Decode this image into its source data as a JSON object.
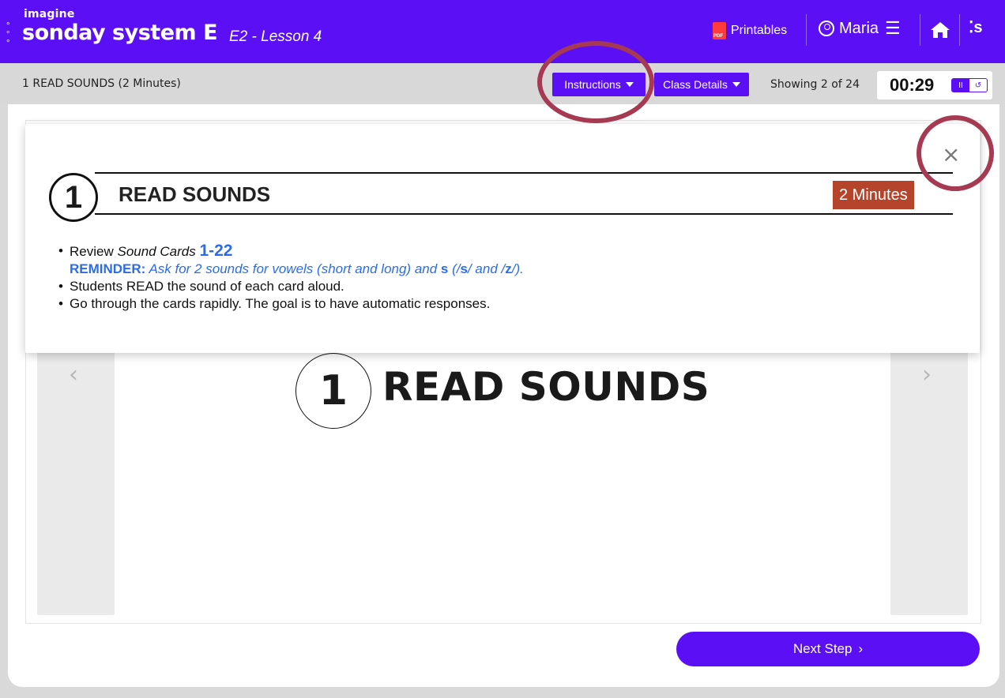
{
  "header": {
    "logo_small": "imagine",
    "logo_main": "sonday system",
    "logo_letter": "E",
    "lesson": "E2 - Lesson 4",
    "printables_label": "Printables",
    "user_name": "Maria",
    "menu_glyph": "☰",
    "s_glyph": "s"
  },
  "subbar": {
    "step_title": "1 READ SOUNDS (2 Minutes)",
    "instructions_label": "Instructions",
    "class_details_label": "Class Details",
    "showing": "Showing 2 of 24",
    "timer": "00:29",
    "pause_glyph": "II",
    "reset_glyph": "↺"
  },
  "popup": {
    "close_glyph": "×",
    "number": "1",
    "title": "READ SOUNDS",
    "minutes": "2 Minutes",
    "bullet1_prefix": "Review",
    "bullet1_italic": "Sound Cards",
    "bullet1_num": "1-22",
    "reminder_label": "REMINDER:",
    "reminder_text": "Ask for 2 sounds for vowels (short and long) and",
    "reminder_s": "s",
    "reminder_open": "(/",
    "reminder_s_sound": "s",
    "reminder_mid": "/ and /",
    "reminder_z_sound": "z",
    "reminder_close": "/).",
    "bullet2": "Students READ the sound of each card aloud.",
    "bullet3": "Go through the cards rapidly. The goal is to have automatic responses."
  },
  "slide": {
    "number": "1",
    "title": "READ SOUNDS",
    "prev_glyph": "‹",
    "next_glyph": "›"
  },
  "footer": {
    "next_step_label": "Next Step",
    "next_step_glyph": "›"
  },
  "colors": {
    "brand_purple": "#5b0ff5",
    "minutes_badge": "#b5452a",
    "link_blue": "#2b6de8",
    "highlight_ring": "#a63a52"
  }
}
